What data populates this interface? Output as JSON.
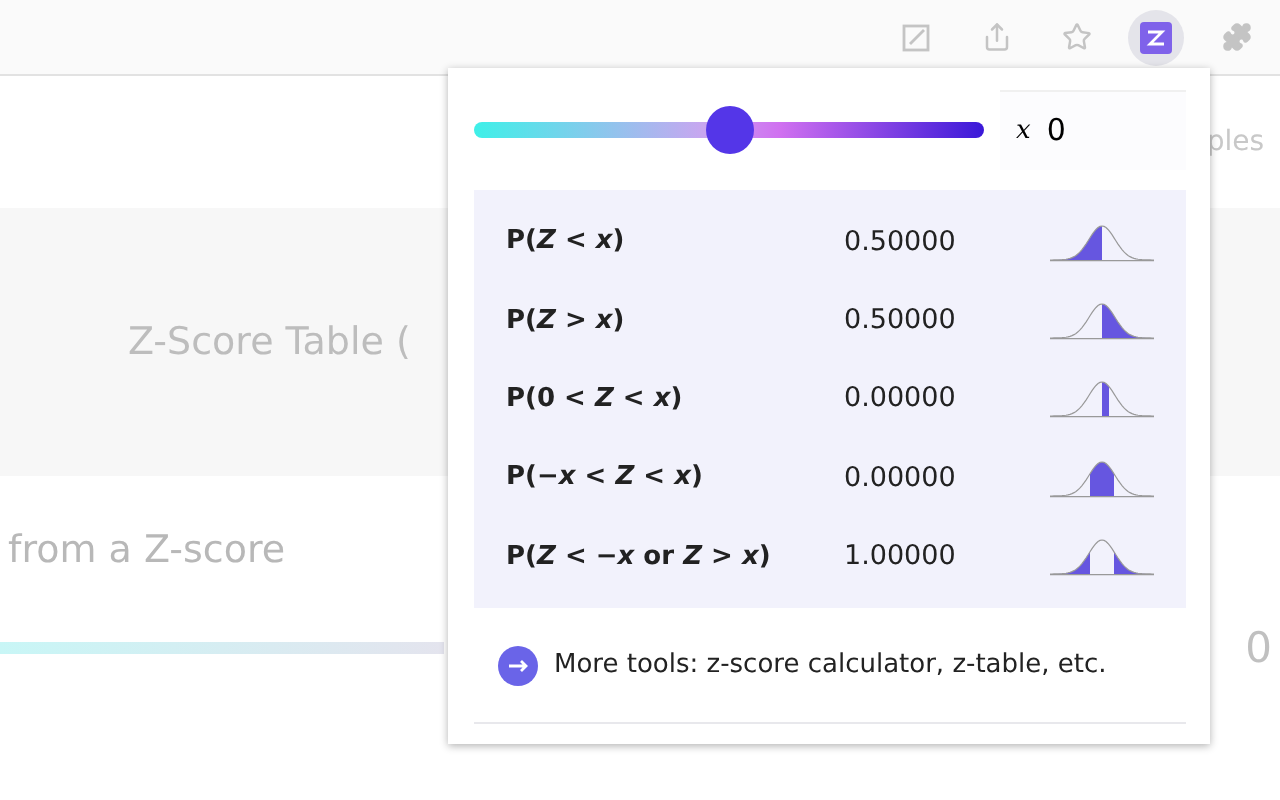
{
  "toolbar": {
    "icons": [
      {
        "kind": "open-square"
      },
      {
        "kind": "share"
      },
      {
        "kind": "star"
      },
      {
        "kind": "extension",
        "selected": true
      },
      {
        "kind": "puzzle"
      }
    ]
  },
  "page": {
    "side_text": "ples",
    "heading": "Z-Score Table (",
    "subheading": "from a Z-score",
    "value_end": "0"
  },
  "popup": {
    "slider": {
      "level": 0.5
    },
    "input": {
      "label": "x",
      "value": "0"
    },
    "results": [
      {
        "label": "P(*Z* < *x*)",
        "value": "0.50000",
        "kind": "left"
      },
      {
        "label": "P(*Z* > *x*)",
        "value": "0.50000",
        "kind": "right"
      },
      {
        "label": "P(0 < *Z* < *x*)",
        "value": "0.00000",
        "kind": "center"
      },
      {
        "label": "P(−*x* < *Z* < *x*)",
        "value": "0.00000",
        "kind": "middle"
      },
      {
        "label": "P(*Z* < −*x* or *Z* > *x*)",
        "value": "1.00000",
        "kind": "tails"
      }
    ],
    "footer_link": "More tools: z-score calculator, z-table, etc."
  }
}
